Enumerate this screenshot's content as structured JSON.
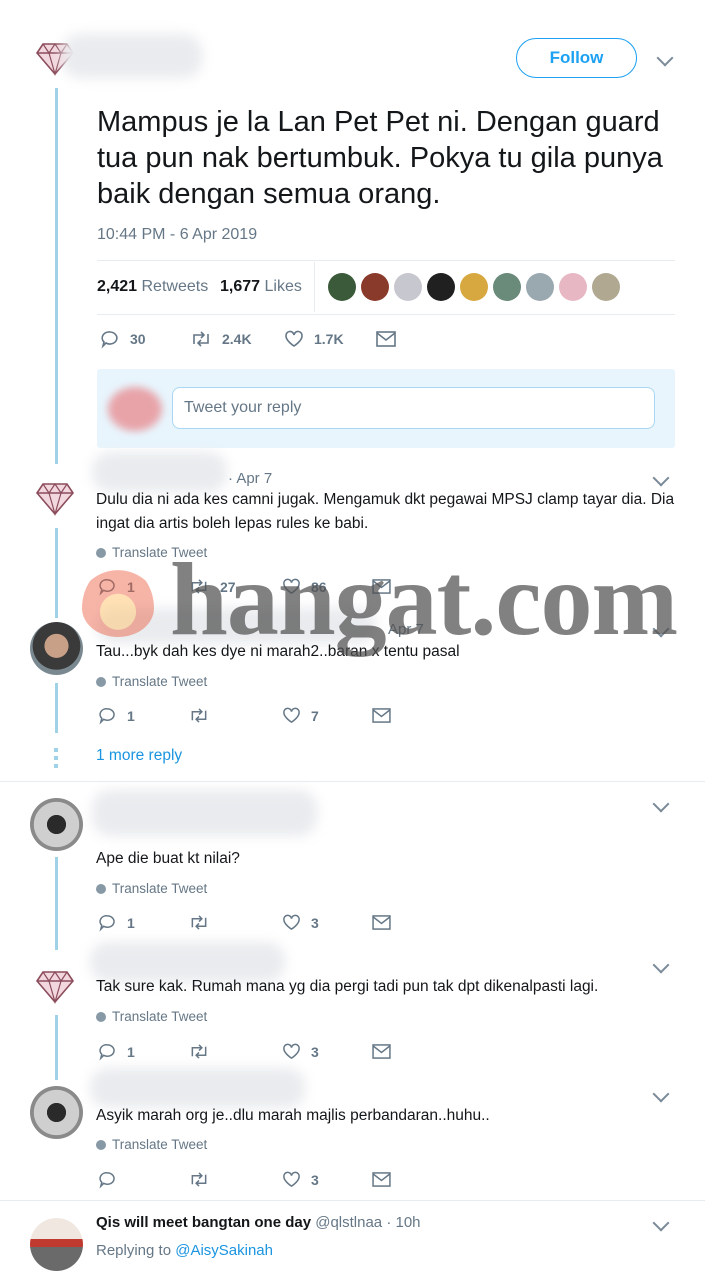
{
  "main_tweet": {
    "follow_label": "Follow",
    "text": "Mampus je la Lan Pet Pet ni. Dengan guard tua pun nak bertumbuk. Pokya tu gila punya baik dengan semua orang.",
    "timestamp": "10:44 PM - 6 Apr 2019",
    "retweets_count": "2,421",
    "retweets_label": "Retweets",
    "likes_count": "1,677",
    "likes_label": "Likes",
    "actions": {
      "replies": "30",
      "retweets": "2.4K",
      "likes": "1.7K"
    }
  },
  "reply_box": {
    "placeholder": "Tweet your reply"
  },
  "replies": [
    {
      "date": "· Apr 7",
      "text": "Dulu dia ni ada kes camni jugak. Mengamuk dkt pegawai MPSJ clamp tayar dia. Dia ingat dia artis boleh lepas rules ke babi.",
      "translate": "Translate Tweet",
      "replies": "1",
      "retweets": "27",
      "likes": "86"
    },
    {
      "date": "Apr 7",
      "text": "Tau...byk dah kes dye ni marah2..baran x tentu pasal",
      "translate": "Translate Tweet",
      "replies": "1",
      "retweets": "",
      "likes": "7"
    },
    {
      "date": "",
      "text": "Ape die buat kt nilai?",
      "translate": "Translate Tweet",
      "replies": "1",
      "retweets": "",
      "likes": "3"
    },
    {
      "date": "",
      "text": "Tak sure kak. Rumah mana yg dia pergi tadi pun tak dpt dikenalpasti lagi.",
      "translate": "Translate Tweet",
      "replies": "1",
      "retweets": "",
      "likes": "3"
    },
    {
      "date": "",
      "text": "Asyik marah org je..dlu marah majlis perbandaran..huhu..",
      "translate": "Translate Tweet",
      "replies": "",
      "retweets": "",
      "likes": "3"
    }
  ],
  "more_replies": "1 more reply",
  "last_tweet": {
    "name": "Qis will meet bangtan one day",
    "handle": "@qlstlnaa · 10h",
    "replying_prefix": "Replying to ",
    "replying_to": "@AisySakinah"
  },
  "watermark": "hangat.com",
  "colors": {
    "accent": "#1da1f2",
    "thread": "#9fd2e6",
    "muted": "#657786"
  }
}
